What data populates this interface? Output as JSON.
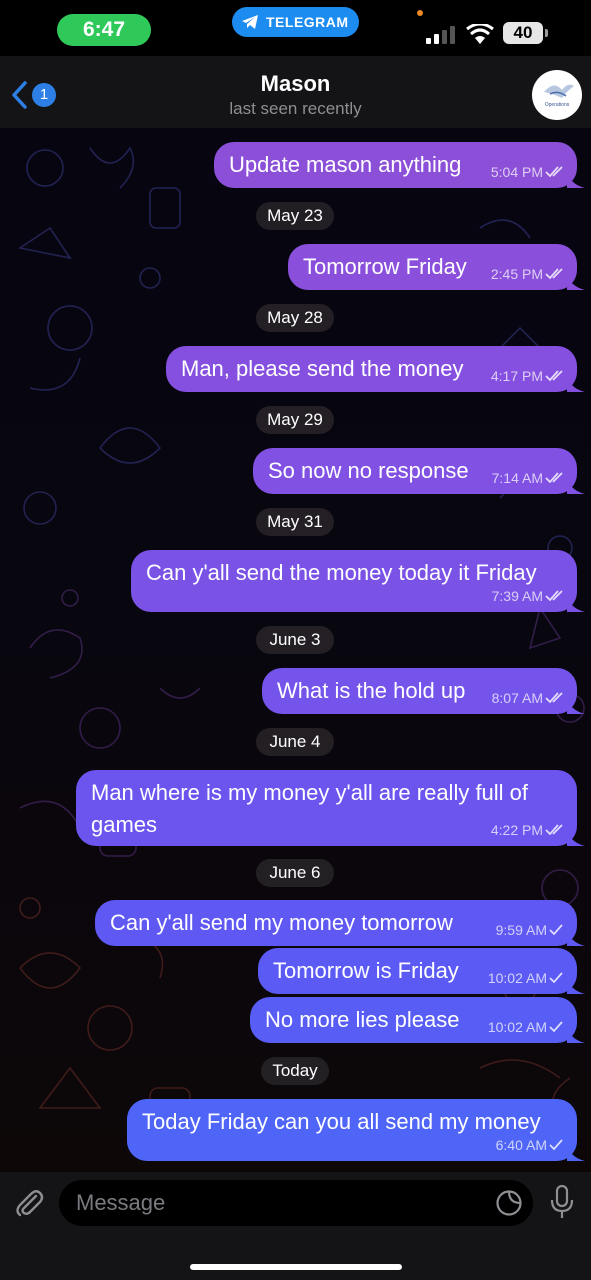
{
  "status_bar": {
    "time": "6:47",
    "app_pill": "TELEGRAM",
    "battery": "40"
  },
  "header": {
    "back_count": "1",
    "contact_name": "Mason",
    "last_seen": "last seen recently",
    "avatar_text": "Operations"
  },
  "messages": [
    {
      "text": "Update mason anything",
      "time": "5:04 PM",
      "read": true,
      "color": "#8b4fd8"
    },
    {
      "date": "May 23"
    },
    {
      "text": "Tomorrow Friday",
      "time": "2:45 PM",
      "read": true,
      "color": "#8a4fdb"
    },
    {
      "date": "May 28"
    },
    {
      "text": "Man, please send the money",
      "time": "4:17 PM",
      "read": true,
      "color": "#8550df"
    },
    {
      "date": "May 29"
    },
    {
      "text": "So now no response",
      "time": "7:14 AM",
      "read": true,
      "color": "#8051e3"
    },
    {
      "date": "May 31"
    },
    {
      "text": "Can y'all send the money today it Friday",
      "time": "7:39 AM",
      "read": true,
      "color": "#7a52e6"
    },
    {
      "date": "June 3"
    },
    {
      "text": "What is the hold up",
      "time": "8:07 AM",
      "read": true,
      "color": "#7454ea"
    },
    {
      "date": "June 4"
    },
    {
      "text": "Man where is my money y'all are really full of games",
      "time": "4:22 PM",
      "read": true,
      "color": "#6b55ee"
    },
    {
      "date": "June 6"
    },
    {
      "text": "Can y'all send my money tomorrow",
      "time": "9:59 AM",
      "read": false,
      "color": "#5f58f2"
    },
    {
      "text": "Tomorrow is Friday",
      "time": "10:02 AM",
      "read": false,
      "color": "#5b5af4"
    },
    {
      "text": "No more lies please",
      "time": "10:02 AM",
      "read": false,
      "color": "#575df5"
    },
    {
      "date": "Today"
    },
    {
      "text": "Today Friday can you all send my money",
      "time": "6:40 AM",
      "read": false,
      "color": "#4f65f7"
    }
  ],
  "input": {
    "placeholder": "Message"
  },
  "colors": {
    "header_bg": "#141416",
    "accent_blue": "#2d7fe6",
    "status_green": "#2fc95a"
  }
}
